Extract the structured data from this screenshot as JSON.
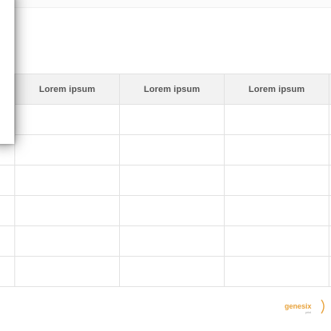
{
  "table": {
    "headers": [
      "Lorem ipsum",
      "Lorem ipsum",
      "Lorem ipsum"
    ],
    "row_count": 6
  },
  "logo": {
    "text": "genesix",
    "subtext": "print",
    "color": "#e8a33d"
  }
}
